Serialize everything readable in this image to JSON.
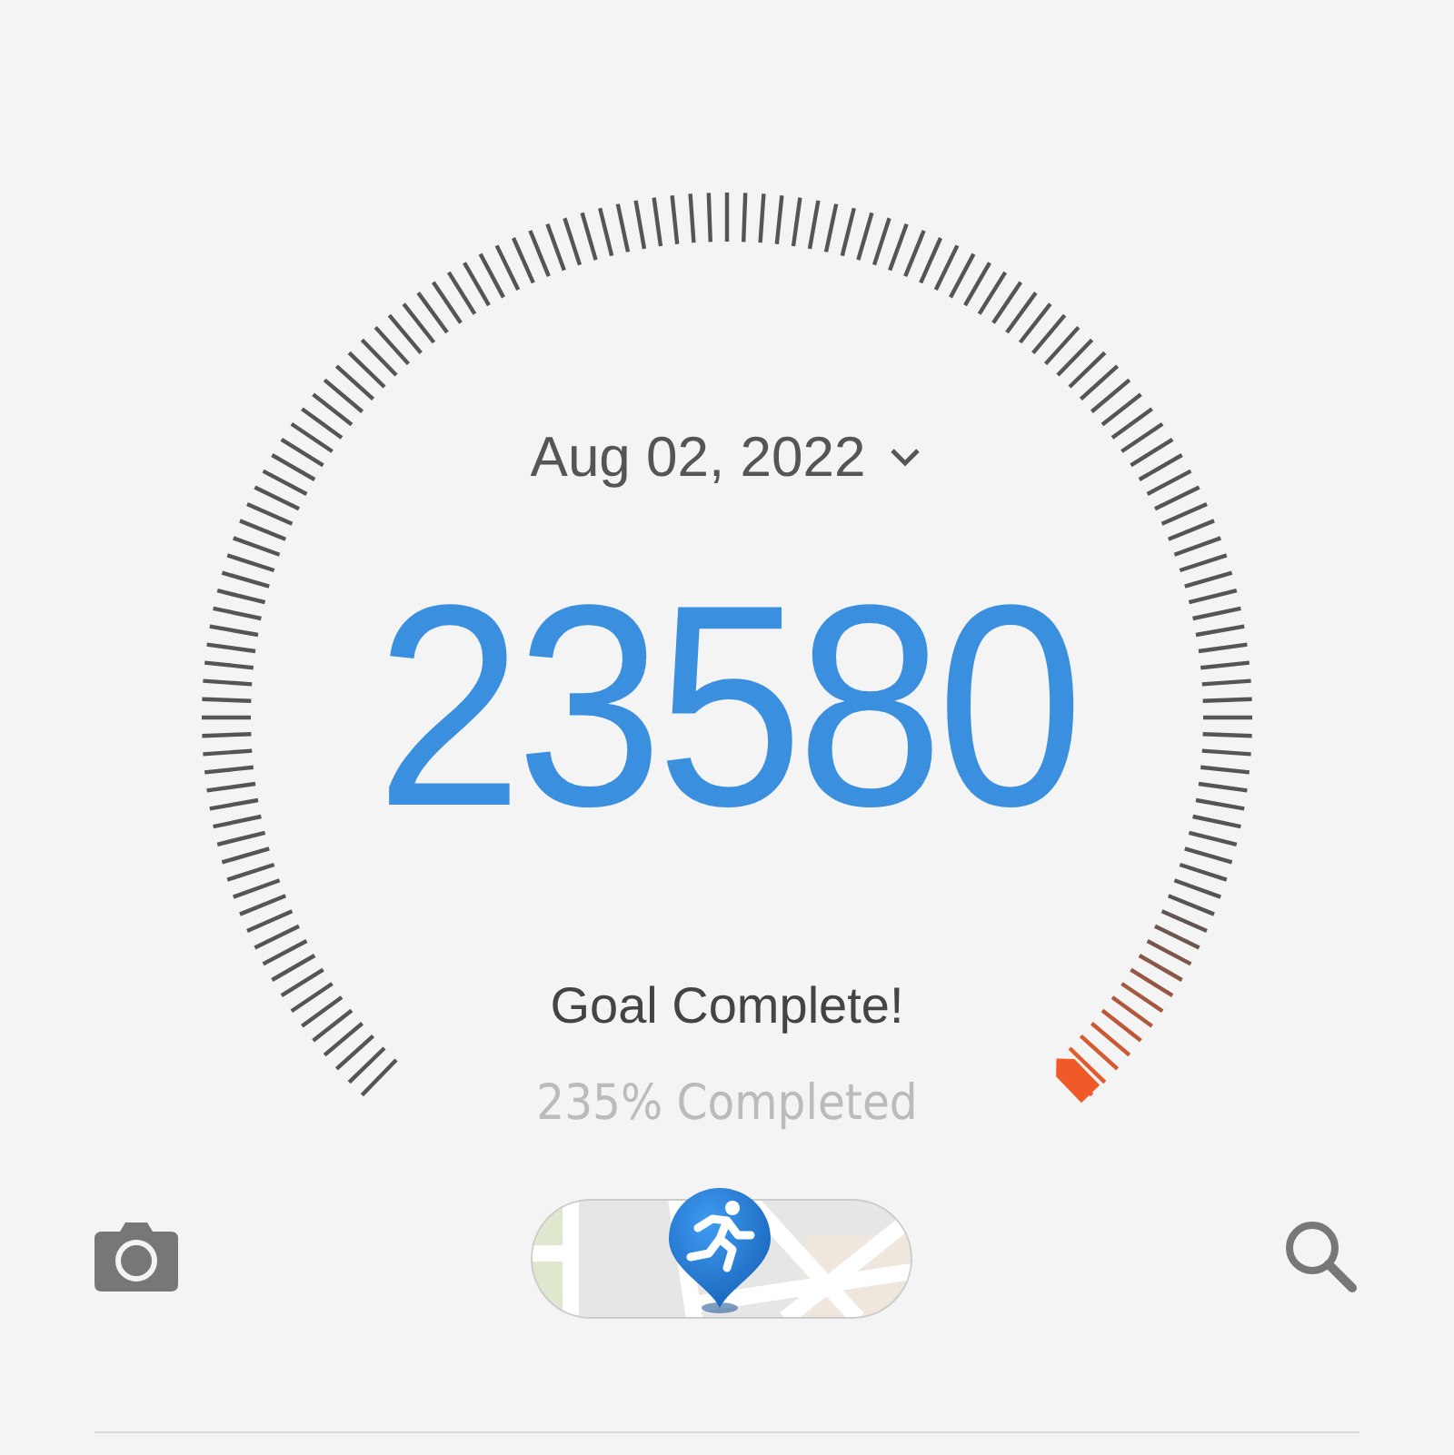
{
  "date": "Aug 02, 2022",
  "steps": "23580",
  "goal_message": "Goal Complete!",
  "completion": "235% Completed"
}
